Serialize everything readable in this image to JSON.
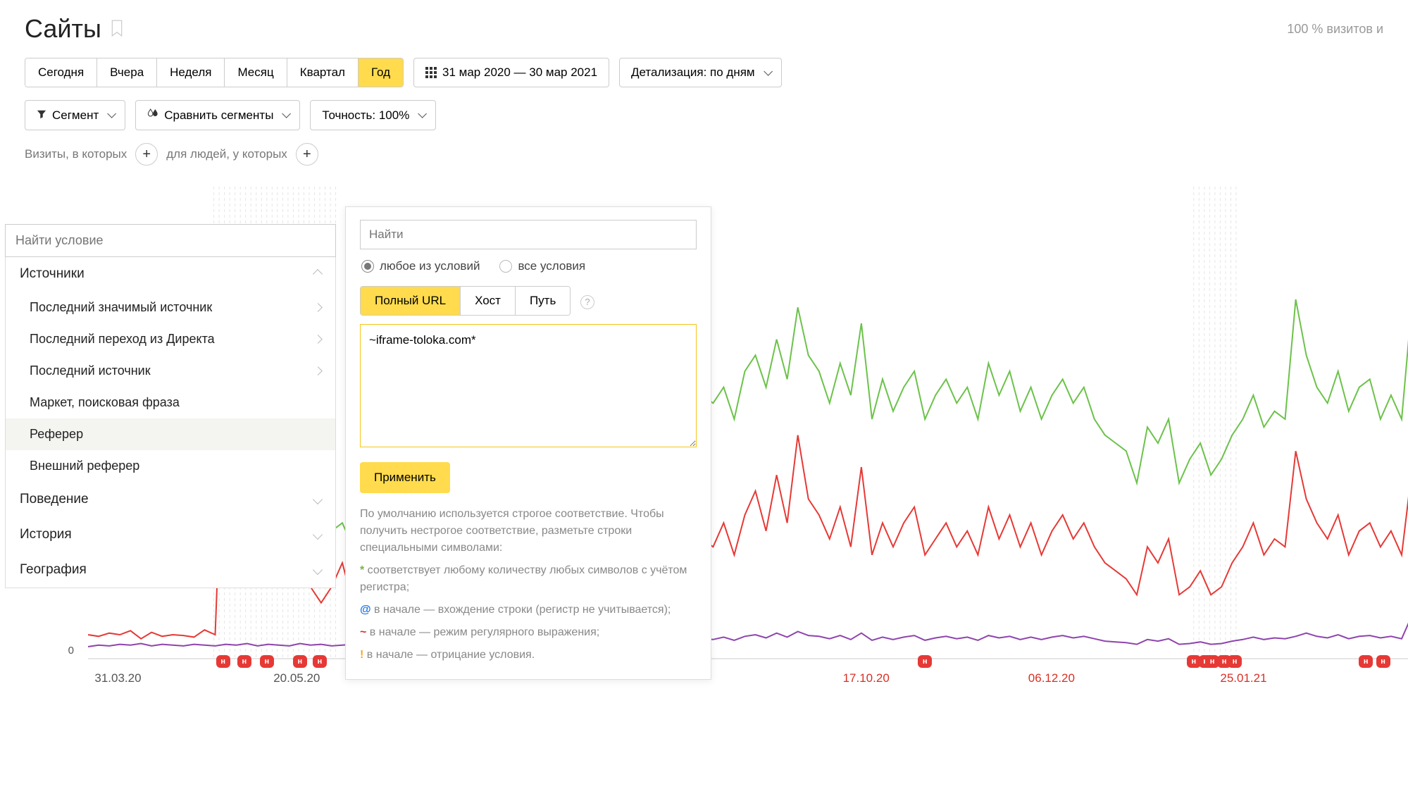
{
  "header": {
    "title": "Сайты",
    "visits_pct": "100 % визитов и"
  },
  "period_tabs": [
    "Сегодня",
    "Вчера",
    "Неделя",
    "Месяц",
    "Квартал",
    "Год"
  ],
  "period_active_index": 5,
  "date_range": "31 мар 2020 — 30 мар 2021",
  "detail": "Детализация: по дням",
  "row2": {
    "segment": "Сегмент",
    "compare": "Сравнить сегменты",
    "accuracy": "Точность: 100%"
  },
  "segbar": {
    "visits_label": "Визиты, в которых",
    "people_label": "для людей, у которых"
  },
  "panel_left": {
    "search_placeholder": "Найти условие",
    "categories": [
      {
        "label": "Источники",
        "open": true,
        "items": [
          {
            "label": "Последний значимый источник",
            "hasArrow": true
          },
          {
            "label": "Последний переход из Директа",
            "hasArrow": true
          },
          {
            "label": "Последний источник",
            "hasArrow": true
          },
          {
            "label": "Маркет, поисковая фраза",
            "hasArrow": false
          },
          {
            "label": "Реферер",
            "hasArrow": false,
            "selected": true
          },
          {
            "label": "Внешний реферер",
            "hasArrow": false
          }
        ]
      },
      {
        "label": "Поведение",
        "open": false
      },
      {
        "label": "История",
        "open": false
      },
      {
        "label": "География",
        "open": false
      }
    ]
  },
  "panel_right": {
    "search_placeholder": "Найти",
    "radio_any": "любое из условий",
    "radio_all": "все условия",
    "url_tabs": [
      "Полный URL",
      "Хост",
      "Путь"
    ],
    "url_tab_active": 0,
    "url_value": "~iframe-toloka.com*",
    "apply": "Применить",
    "hint_lead": "По умолчанию используется строгое соответствие. Чтобы получить нестрогое соответствие, разметьте строки специальными символами:",
    "hint_star": "соответствует любому количеству любых символов с учётом регистра;",
    "hint_at": "в начале — вхождение строки (регистр не учитывается);",
    "hint_tilde": "в начале — режим регулярного выражения;",
    "hint_bang": "в начале — отрицание условия."
  },
  "chart_data": {
    "type": "line",
    "xlabel": "",
    "ylabel": "",
    "ylim": [
      0,
      60000
    ],
    "x_ticks": [
      "31.03.20",
      "20.05.20",
      "17.10.20",
      "06.12.20",
      "25.01.21"
    ],
    "x_tick_pos": [
      0.005,
      0.14,
      0.57,
      0.71,
      0.855
    ],
    "y_ticks": [
      0
    ],
    "series": [
      {
        "name": "green",
        "color": "#6cc24a",
        "values": [
          15000,
          14000,
          16000,
          13000,
          17000,
          15000,
          18000,
          14000,
          16000,
          15000,
          14000,
          17000,
          15000,
          18000,
          14000,
          16000,
          13000,
          15000,
          14000,
          17000,
          16000,
          15000,
          14000,
          16000,
          17000,
          14000,
          13000,
          16000,
          15000,
          14000,
          15000,
          28000,
          30000,
          35000,
          40000,
          38000,
          45000,
          40000,
          42000,
          37000,
          48000,
          36000,
          38000,
          34000,
          36000,
          33000,
          35000,
          32000,
          34000,
          33000,
          36000,
          32000,
          30000,
          34000,
          31000,
          36000,
          29000,
          35000,
          33000,
          32000,
          34000,
          30000,
          36000,
          38000,
          34000,
          40000,
          35000,
          44000,
          38000,
          36000,
          32000,
          37000,
          33000,
          42000,
          30000,
          35000,
          31000,
          34000,
          36000,
          30000,
          33000,
          35000,
          32000,
          34000,
          30000,
          37000,
          33000,
          36000,
          31000,
          34000,
          30000,
          33000,
          35000,
          32000,
          34000,
          30000,
          28000,
          27000,
          26000,
          22000,
          29000,
          27000,
          30000,
          22000,
          25000,
          27000,
          23000,
          25000,
          28000,
          30000,
          33000,
          29000,
          31000,
          30000,
          45000,
          38000,
          34000,
          32000,
          36000,
          31000,
          34000,
          35000,
          30000,
          33000,
          30000,
          45000
        ]
      },
      {
        "name": "red",
        "color": "#e63935",
        "values": [
          3000,
          2800,
          3200,
          3000,
          3500,
          2500,
          3300,
          2800,
          3000,
          2900,
          2700,
          3600,
          3000,
          38000,
          36000,
          34000,
          30000,
          28000,
          23000,
          25000,
          11000,
          9000,
          7000,
          9000,
          12000,
          7000,
          6000,
          8000,
          9000,
          7000,
          8000,
          20000,
          25000,
          22000,
          28000,
          24000,
          27000,
          22000,
          24000,
          20000,
          26000,
          18000,
          22000,
          17000,
          19000,
          16000,
          18000,
          15000,
          17000,
          16000,
          19000,
          14000,
          13000,
          16000,
          14000,
          18000,
          12000,
          16000,
          15000,
          14000,
          17000,
          13000,
          18000,
          21000,
          16000,
          23000,
          17000,
          28000,
          20000,
          18000,
          15000,
          19000,
          14000,
          24000,
          13000,
          17000,
          14000,
          17000,
          19000,
          13000,
          15000,
          17000,
          14000,
          16000,
          13000,
          19000,
          15000,
          18000,
          14000,
          17000,
          13000,
          16000,
          18000,
          15000,
          17000,
          14000,
          12000,
          11000,
          10000,
          8000,
          14000,
          12000,
          15000,
          8000,
          9000,
          11000,
          8000,
          9000,
          12000,
          14000,
          17000,
          13000,
          15000,
          14000,
          26000,
          20000,
          17000,
          15000,
          18000,
          13000,
          16000,
          17000,
          14000,
          16000,
          13000,
          24000
        ]
      },
      {
        "name": "purple",
        "color": "#8e44ad",
        "values": [
          1500,
          1700,
          1600,
          1800,
          1700,
          1900,
          1600,
          1800,
          1700,
          1600,
          1800,
          1700,
          1600,
          1800,
          1700,
          1900,
          1600,
          1800,
          1700,
          1600,
          1900,
          1700,
          1800,
          1600,
          1700,
          1800,
          1600,
          1700,
          1800,
          1700,
          1800,
          2800,
          3000,
          2900,
          3200,
          3100,
          3300,
          3000,
          3100,
          2800,
          3200,
          2700,
          2900,
          2600,
          2800,
          2500,
          2700,
          2400,
          2600,
          2500,
          2800,
          2400,
          2300,
          2600,
          2400,
          2800,
          2200,
          2600,
          2500,
          2400,
          2700,
          2300,
          2800,
          3000,
          2600,
          3200,
          2700,
          3400,
          2900,
          2800,
          2500,
          2900,
          2400,
          3200,
          2300,
          2700,
          2400,
          2700,
          2900,
          2300,
          2600,
          2800,
          2500,
          2700,
          2300,
          2900,
          2600,
          2800,
          2400,
          2700,
          2400,
          2700,
          2900,
          2600,
          2800,
          2500,
          2200,
          2100,
          2000,
          1800,
          2400,
          2200,
          2500,
          1800,
          1900,
          2100,
          1800,
          1900,
          2200,
          2400,
          2700,
          2400,
          2600,
          2500,
          2800,
          3200,
          2800,
          2600,
          3000,
          2500,
          2800,
          2900,
          2600,
          2800,
          2500,
          5500
        ]
      }
    ],
    "markers_h": [
      0.102,
      0.118,
      0.135,
      0.16,
      0.175,
      0.632,
      0.835,
      0.844,
      0.849,
      0.858,
      0.866,
      0.965,
      0.978
    ]
  }
}
